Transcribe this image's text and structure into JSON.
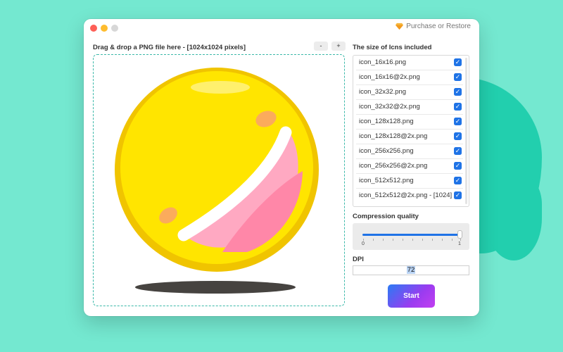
{
  "window": {
    "purchase_label": "Purchase or Restore"
  },
  "drop_zone": {
    "label": "Drag & drop a PNG file here - [1024x1024 pixels]",
    "zoom_out_label": "-",
    "zoom_in_label": "+"
  },
  "icns_section": {
    "title": "The size of Icns included",
    "items": [
      {
        "label": "icon_16x16.png",
        "checked": true
      },
      {
        "label": "icon_16x16@2x.png",
        "checked": true
      },
      {
        "label": "icon_32x32.png",
        "checked": true
      },
      {
        "label": "icon_32x32@2x.png",
        "checked": true
      },
      {
        "label": "icon_128x128.png",
        "checked": true
      },
      {
        "label": "icon_128x128@2x.png",
        "checked": true
      },
      {
        "label": "icon_256x256.png",
        "checked": true
      },
      {
        "label": "icon_256x256@2x.png",
        "checked": true
      },
      {
        "label": "icon_512x512.png",
        "checked": true
      },
      {
        "label": "icon_512x512@2x.png - [1024]",
        "checked": true
      }
    ],
    "check_glyph": "✓"
  },
  "compression": {
    "title": "Compression quality",
    "min_label": "0",
    "max_label": "1",
    "value": 1
  },
  "dpi": {
    "title": "DPI",
    "value": "72"
  },
  "start_label": "Start",
  "colors": {
    "background": "#74e8d0",
    "accent_blue": "#1f73e6",
    "drop_border": "#3bb9a9",
    "ball_yellow": "#ffe500",
    "button_gradient_start": "#2a7bf4",
    "button_gradient_end": "#c23ff0"
  }
}
